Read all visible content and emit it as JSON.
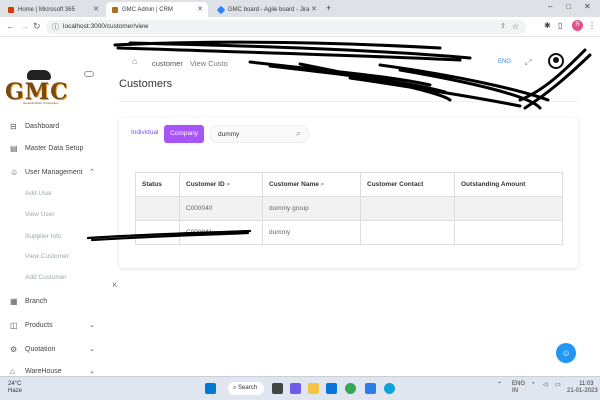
{
  "browser": {
    "tabs": [
      {
        "label": "Home | Microsoft 365",
        "icon": "office-icon",
        "color": "#d83b01"
      },
      {
        "label": "GMC Admin | CRM",
        "icon": "gmc-icon",
        "color": "#b06d1a"
      },
      {
        "label": "GMC board - Agile board - Jira",
        "icon": "jira-icon",
        "color": "#2684ff"
      }
    ],
    "new_tab": "+",
    "url": "localhost:3000/customer/view",
    "profile_initial": "R"
  },
  "sidebar": {
    "logo_text": "GMC",
    "logo_tagline": "General Motor Corporation",
    "items": [
      {
        "label": "Dashboard",
        "icon": "dashboard-icon"
      },
      {
        "label": "Master Data Setup",
        "icon": "doc-icon"
      },
      {
        "label": "User Management",
        "icon": "user-icon"
      },
      {
        "label": "Branch",
        "icon": "branch-icon"
      },
      {
        "label": "Products",
        "icon": "box-icon"
      },
      {
        "label": "Quotation",
        "icon": "quote-icon"
      },
      {
        "label": "WareHouse",
        "icon": "warehouse-icon"
      }
    ],
    "subitems": [
      "Add User",
      "View User",
      "Supplier Info",
      "View Customer",
      "Add Customer"
    ]
  },
  "topbar": {
    "crumb1": "customer",
    "crumb2": "View Custo",
    "lang": "ENG"
  },
  "page": {
    "title": "Customers",
    "segment_individual": "Individual",
    "segment_company": "Company",
    "search_value": "dummy",
    "k_label": "K"
  },
  "table": {
    "headers": [
      "Status",
      "Customer ID",
      "Customer Name",
      "Customer Contact",
      "Outstanding Amount"
    ],
    "rows": [
      [
        "",
        "C000040",
        "dummy group",
        "",
        ""
      ],
      [
        "",
        "C000041",
        "dummy",
        "",
        ""
      ]
    ]
  },
  "taskbar": {
    "temp": "24°C",
    "weather": "Haze",
    "search": "Search",
    "lang": "ENG",
    "lang2": "IN",
    "time": "11:03",
    "date": "21-01-2023"
  },
  "colors": {
    "accent": "#a855f7",
    "fab": "#2196f3"
  }
}
